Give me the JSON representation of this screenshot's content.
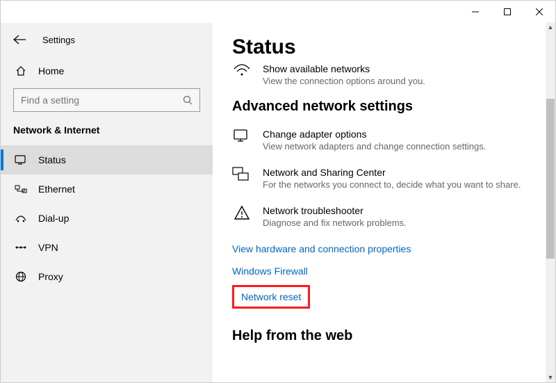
{
  "app": {
    "title": "Settings"
  },
  "sidebar": {
    "home_label": "Home",
    "search_placeholder": "Find a setting",
    "category": "Network & Internet",
    "items": [
      {
        "label": "Status",
        "icon": "status-icon",
        "selected": true
      },
      {
        "label": "Ethernet",
        "icon": "ethernet-icon",
        "selected": false
      },
      {
        "label": "Dial-up",
        "icon": "dialup-icon",
        "selected": false
      },
      {
        "label": "VPN",
        "icon": "vpn-icon",
        "selected": false
      },
      {
        "label": "Proxy",
        "icon": "proxy-icon",
        "selected": false
      }
    ]
  },
  "main": {
    "page_title": "Status",
    "truncated_item": {
      "title": "Show available networks",
      "sub": "View the connection options around you."
    },
    "section_heading": "Advanced network settings",
    "options": [
      {
        "title": "Change adapter options",
        "sub": "View network adapters and change connection settings."
      },
      {
        "title": "Network and Sharing Center",
        "sub": "For the networks you connect to, decide what you want to share."
      },
      {
        "title": "Network troubleshooter",
        "sub": "Diagnose and fix network problems."
      }
    ],
    "links": {
      "hardware": "View hardware and connection properties",
      "firewall": "Windows Firewall",
      "reset": "Network reset"
    },
    "help_heading": "Help from the web"
  }
}
